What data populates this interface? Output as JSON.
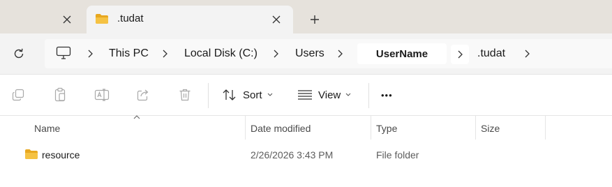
{
  "tabs": [
    {
      "label": "",
      "state": "inactive"
    },
    {
      "label": ".tudat",
      "state": "active",
      "icon": "folder-icon"
    }
  ],
  "tab_close_glyph": "✕",
  "new_tab_glyph": "+",
  "breadcrumb": {
    "items": [
      "This PC",
      "Local Disk (C:)",
      "Users",
      "UserName",
      ".tudat"
    ],
    "root_icon": "computer-icon",
    "trailing_chevron": true
  },
  "toolbar": {
    "icons": [
      "copy-icon",
      "paste-icon",
      "rename-icon",
      "share-icon",
      "delete-icon"
    ],
    "sort_label": "Sort",
    "view_label": "View",
    "more_label": "•••"
  },
  "file_list": {
    "columns": [
      "Name",
      "Date modified",
      "Type",
      "Size"
    ],
    "sort_column": "Name",
    "rows": [
      {
        "name": "resource",
        "date_modified": "2/26/2026 3:43 PM",
        "type": "File folder",
        "size": ""
      }
    ]
  },
  "colors": {
    "tab_strip": "#e6e2dc",
    "address_row": "#f3f3f3",
    "folder_yellow": "#f5c243",
    "text": "#1b1b1b"
  }
}
